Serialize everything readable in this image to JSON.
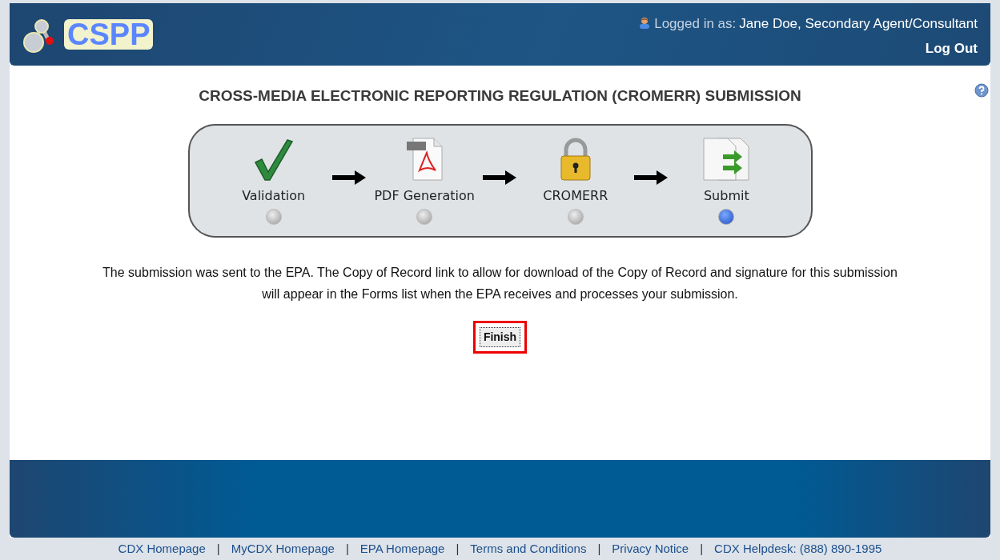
{
  "header": {
    "logo_text": "CSPP",
    "logged_in_label": "Logged in as:",
    "user": "Jane Doe, Secondary Agent/Consultant",
    "logout": "Log Out"
  },
  "title": "CROSS-MEDIA ELECTRONIC REPORTING REGULATION (CROMERR) SUBMISSION",
  "steps": [
    {
      "label": "Validation",
      "kind": "check",
      "selected": false
    },
    {
      "label": "PDF Generation",
      "kind": "pdf",
      "selected": false
    },
    {
      "label": "CROMERR",
      "kind": "lock",
      "selected": false
    },
    {
      "label": "Submit",
      "kind": "submit",
      "selected": true
    }
  ],
  "message": "The submission was sent to the EPA. The Copy of Record link to allow for download of the Copy of Record and signature for this submission will appear in the Forms list when the EPA receives and processes your submission.",
  "finish_button": {
    "label": "Finish",
    "highlighted": true
  },
  "footer": {
    "separator": "|",
    "links": [
      "CDX Homepage",
      "MyCDX Homepage",
      "EPA Homepage",
      "Terms and Conditions",
      "Privacy Notice",
      "CDX Helpdesk: (888) 890-1995"
    ]
  }
}
